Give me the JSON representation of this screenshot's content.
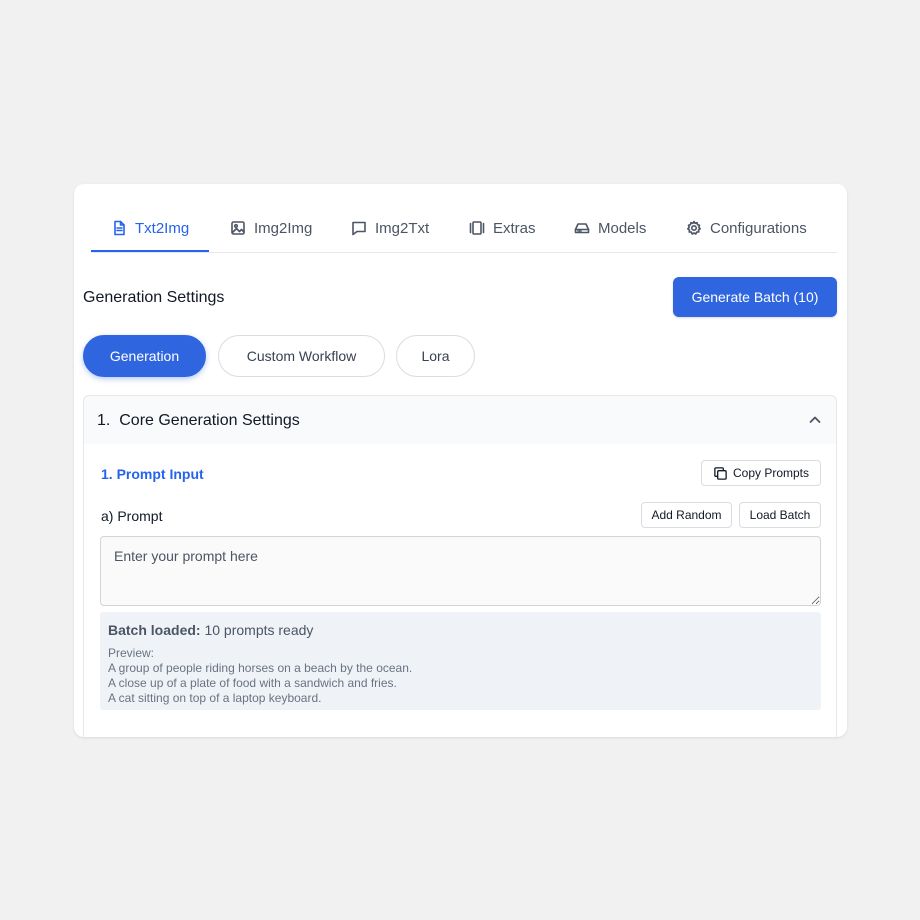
{
  "tabs": [
    {
      "label": "Txt2Img",
      "icon": "document-icon",
      "active": true
    },
    {
      "label": "Img2Img",
      "icon": "image-icon",
      "active": false
    },
    {
      "label": "Img2Txt",
      "icon": "chat-icon",
      "active": false
    },
    {
      "label": "Extras",
      "icon": "columns-icon",
      "active": false
    },
    {
      "label": "Models",
      "icon": "drive-icon",
      "active": false
    },
    {
      "label": "Configurations",
      "icon": "gear-icon",
      "active": false
    }
  ],
  "header": {
    "title": "Generation Settings",
    "generate_button": "Generate Batch (10)"
  },
  "pills": [
    {
      "label": "Generation",
      "active": true
    },
    {
      "label": "Custom Workflow",
      "active": false
    },
    {
      "label": "Lora",
      "active": false
    }
  ],
  "accordion": {
    "title": "1.  Core Generation Settings",
    "subsection": "1. Prompt Input",
    "copy_button": "Copy Prompts",
    "prompt_label": "a) Prompt",
    "add_random_button": "Add Random",
    "load_batch_button": "Load Batch",
    "prompt_placeholder": "Enter your prompt here",
    "prompt_value": "",
    "batch": {
      "label": "Batch loaded:",
      "status": " 10 prompts ready",
      "preview_label": "Preview:",
      "preview": [
        "A group of people riding horses on a beach by the ocean.",
        "A close up of a plate of food with a sandwich and fries.",
        "A cat sitting on top of a laptop keyboard."
      ]
    }
  },
  "colors": {
    "accent": "#2f66e0",
    "active_tab": "#2563eb",
    "page_bg": "#f1f1f1",
    "batch_bg": "#eff3f8"
  }
}
